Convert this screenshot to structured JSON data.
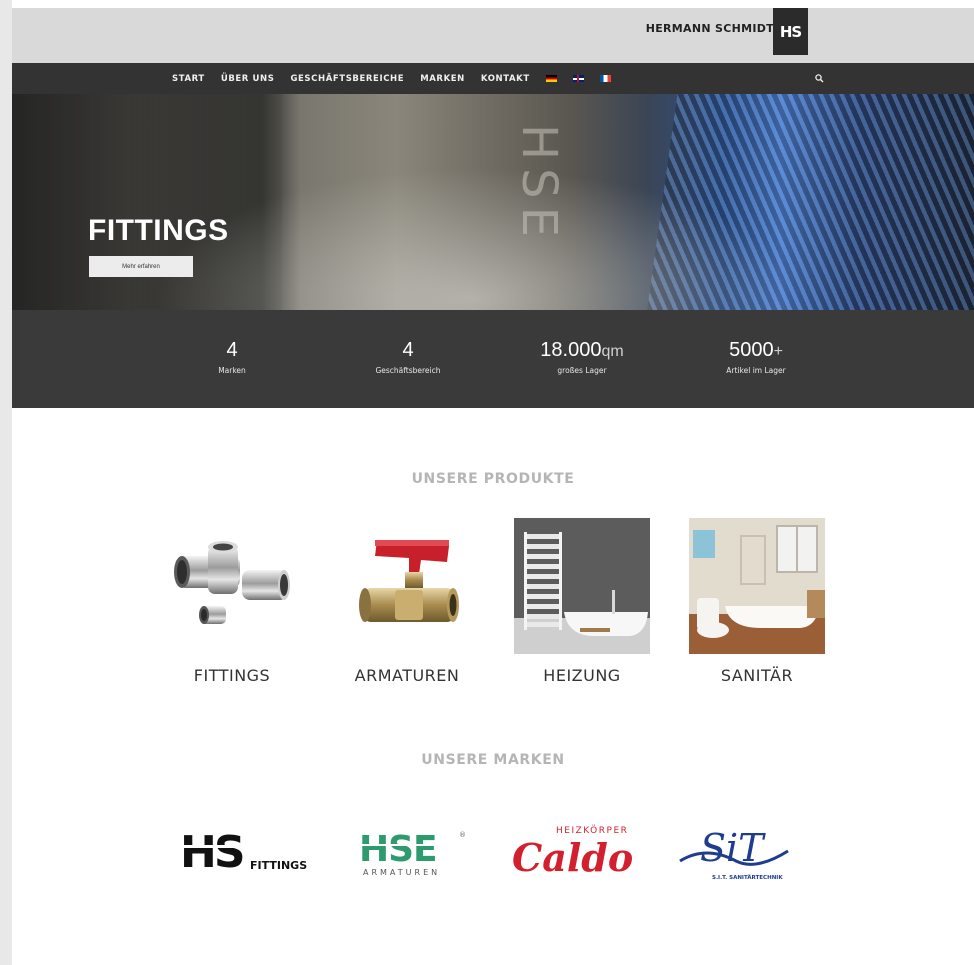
{
  "header": {
    "brand_name": "HERMANN SCHMIDT",
    "logo_text": "HS"
  },
  "nav": {
    "items": [
      "START",
      "ÜBER UNS",
      "GESCHÄFTSBEREICHE",
      "MARKEN",
      "KONTAKT"
    ],
    "flags": [
      "flag-de-icon",
      "flag-en-icon",
      "flag-fr-icon"
    ],
    "search_icon": "search-icon"
  },
  "hero": {
    "title": "FITTINGS",
    "button_label": "Mehr erfahren",
    "engraving": "HSE"
  },
  "stats": [
    {
      "value": "4",
      "unit": "",
      "label": "Marken"
    },
    {
      "value": "4",
      "unit": "",
      "label": "Geschäftsbereich"
    },
    {
      "value": "18.000",
      "unit": "qm",
      "label": "großes Lager"
    },
    {
      "value": "5000",
      "unit": "+",
      "label": "Artikel im Lager"
    }
  ],
  "products": {
    "title": "UNSERE PRODUKTE",
    "items": [
      {
        "label": "FITTINGS"
      },
      {
        "label": "ARMATUREN"
      },
      {
        "label": "HEIZUNG"
      },
      {
        "label": "SANITÄR"
      }
    ]
  },
  "brands": {
    "title": "UNSERE MARKEN",
    "items": [
      {
        "logo_text": "HS",
        "sub": "FITTINGS"
      },
      {
        "logo_text": "HSE",
        "sub": "ARMATUREN"
      },
      {
        "logo_text": "Caldo",
        "sub": "HEIZKÖRPER"
      },
      {
        "logo_text": "SiT",
        "sub": "S.I.T. SANITÄRTECHNIK"
      }
    ]
  },
  "colors": {
    "header_bg": "#d9d9d9",
    "nav_bg": "#333333",
    "stats_bg": "#3a3a3a",
    "hse_green": "#2e9b6e",
    "caldo_red": "#d3202e",
    "sit_blue": "#1f3d8f"
  }
}
